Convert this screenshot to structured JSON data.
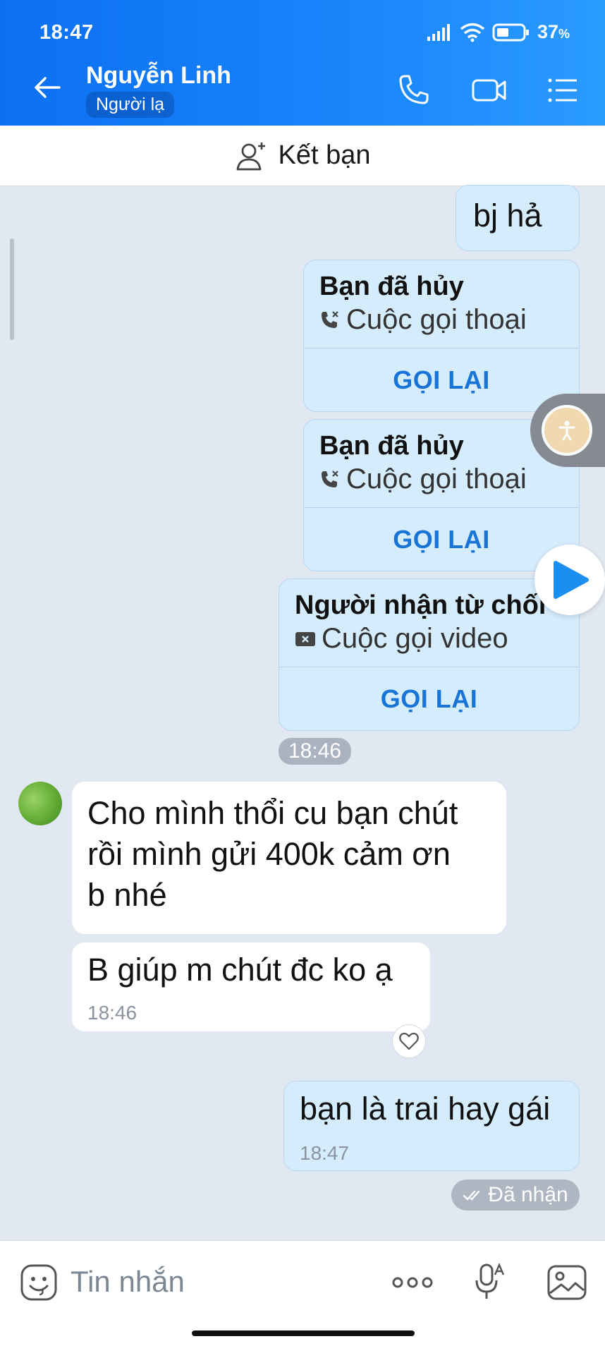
{
  "status_bar": {
    "time": "18:47",
    "battery": "37"
  },
  "header": {
    "contact_name": "Nguyễn Linh",
    "badge": "Người lạ"
  },
  "friend_bar": {
    "label": "Kết bạn"
  },
  "messages": {
    "m1": {
      "text": "bj hả"
    },
    "call1": {
      "title": "Bạn đã hủy",
      "subtitle": "Cuộc gọi thoại",
      "action": "GỌI LẠI"
    },
    "call2": {
      "title": "Bạn đã hủy",
      "subtitle": "Cuộc gọi thoại",
      "action": "GỌI LẠI"
    },
    "call3": {
      "title": "Người nhận từ chối",
      "subtitle": "Cuộc gọi video",
      "action": "GỌI LẠI"
    },
    "time_chip": "18:46",
    "in1": {
      "lines": [
        "Cho mình thổi cu bạn chút",
        "rồi mình gửi 400k cảm ơn",
        "b nhé"
      ]
    },
    "in2": {
      "text": "B giúp m chút đc ko ạ",
      "time": "18:46"
    },
    "out_last": {
      "text": "bạn là trai hay gái",
      "time": "18:47"
    },
    "delivery_status": "Đã nhận"
  },
  "input": {
    "placeholder": "Tin nhắn"
  },
  "colors": {
    "accent": "#1874d6",
    "out_bubble": "#d5ecfd",
    "header": "#0b6ff2"
  }
}
